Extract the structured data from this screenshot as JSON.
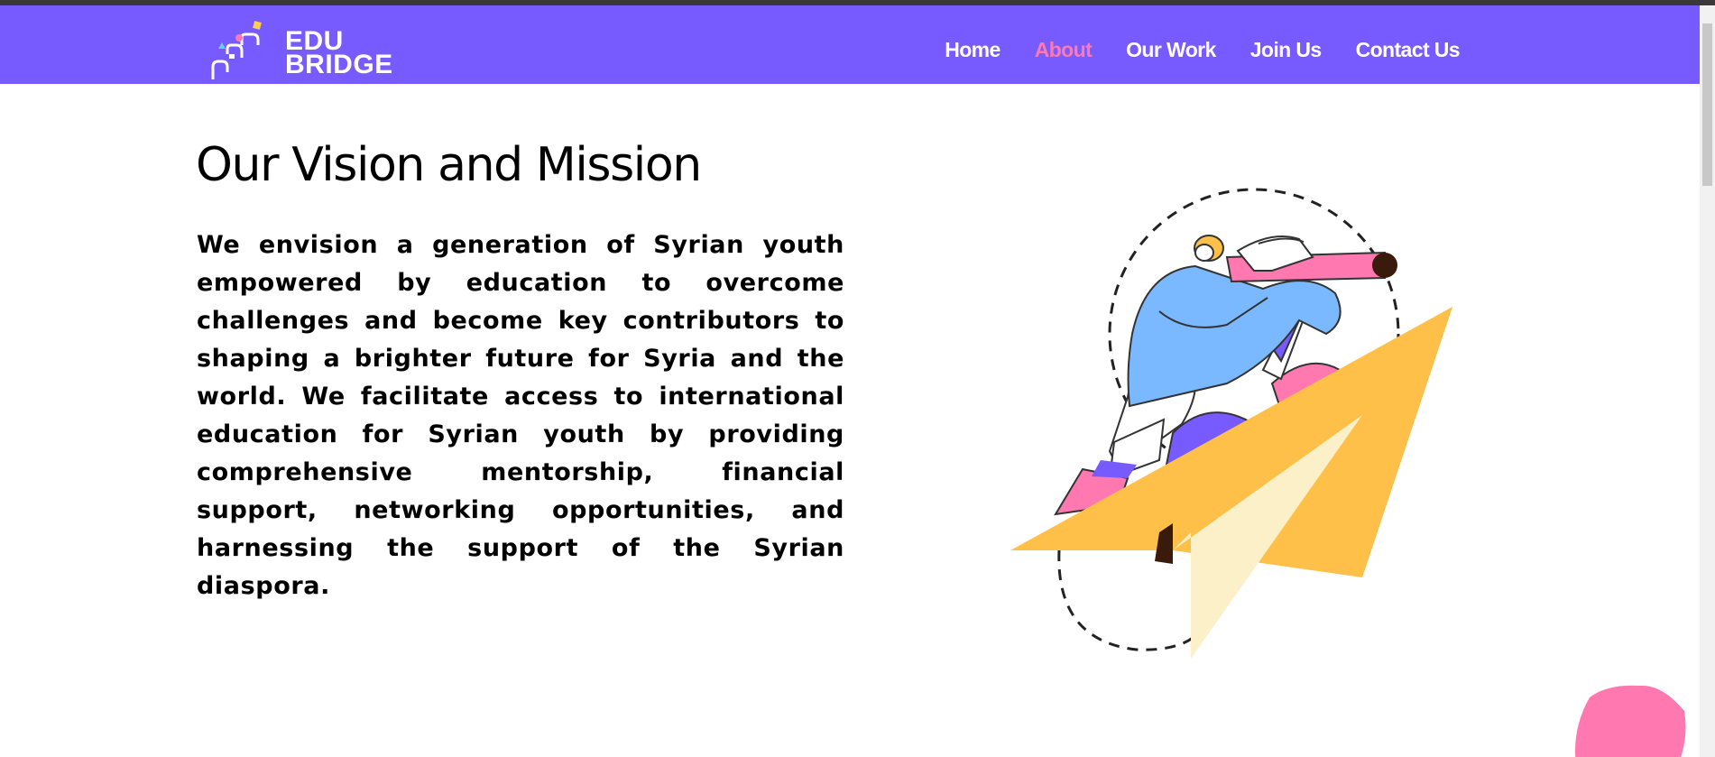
{
  "header": {
    "logo": {
      "line1": "EDU",
      "line2": "BRIDGE"
    },
    "nav": [
      {
        "label": "Home",
        "active": false
      },
      {
        "label": "About",
        "active": true
      },
      {
        "label": "Our Work",
        "active": false
      },
      {
        "label": "Join Us",
        "active": false
      },
      {
        "label": "Contact Us",
        "active": false
      }
    ]
  },
  "main": {
    "title": "Our Vision and Mission",
    "body": "We envision a generation of Syrian youth empowered by education to overcome challenges and become key contributors to shaping a brighter future for Syria and the world. We facilitate access to international education for Syrian youth by providing comprehensive mentorship, financial support, networking opportunities, and harnessing the support of the Syrian diaspora.",
    "illustration": "paper-plane-explorer-illustration"
  },
  "colors": {
    "brand": "#785bfe",
    "accent": "#ff79b0",
    "plane": "#ffc04a",
    "shirt": "#7ab8ff"
  }
}
